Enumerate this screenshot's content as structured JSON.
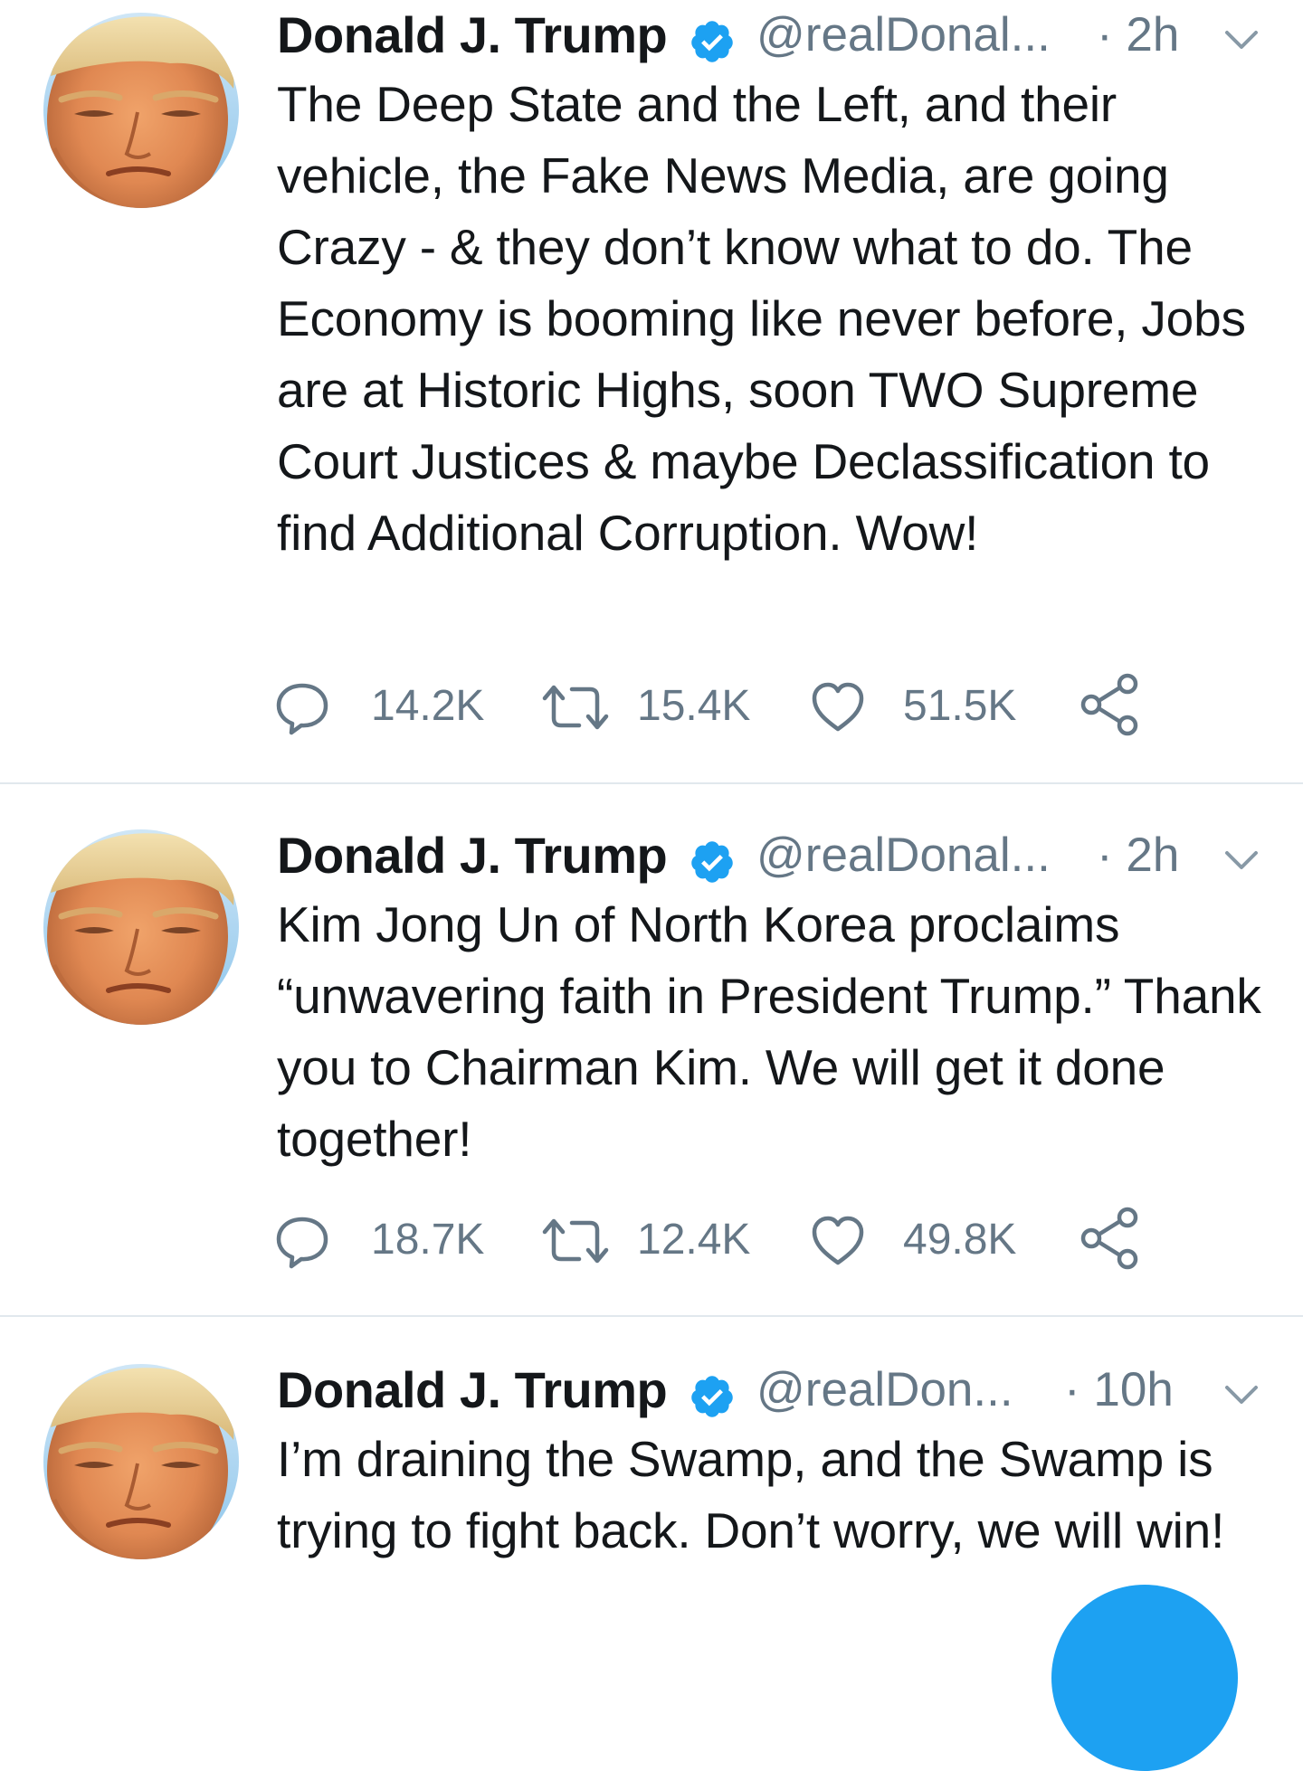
{
  "colors": {
    "accent": "#1da1f2",
    "text_primary": "#14171a",
    "text_secondary": "#657786",
    "divider": "#e1e8ed"
  },
  "tweets": [
    {
      "name": "Donald J. Trump",
      "handle": "@realDonal...",
      "time": "· 2h",
      "text": "The Deep State and the Left, and their vehicle, the Fake News Media, are going Crazy - & they don’t know what to do. The Economy is booming like never before, Jobs are at Historic Highs, soon TWO Supreme Court Justices & maybe Declassification to find Additional Corruption. Wow!",
      "replies": "14.2K",
      "retweets": "15.4K",
      "likes": "51.5K"
    },
    {
      "name": "Donald J. Trump",
      "handle": "@realDonal...",
      "time": "· 2h",
      "text": "Kim Jong Un of North Korea proclaims “unwavering faith in President Trump.” Thank you to Chairman Kim. We will get it done together!",
      "replies": "18.7K",
      "retweets": "12.4K",
      "likes": "49.8K"
    },
    {
      "name": "Donald J. Trump",
      "handle": "@realDon...",
      "time": "· 10h",
      "text": "I’m draining the Swamp, and the Swamp is trying to fight back. Don’t worry, we will win!"
    }
  ],
  "icons": {
    "avatar": "profile-photo",
    "verified": "verified-badge-icon",
    "menu": "chevron-down-icon",
    "reply": "reply-bubble-icon",
    "retweet": "retweet-icon",
    "like": "heart-icon",
    "share": "share-icon",
    "compose": "compose-fab"
  }
}
